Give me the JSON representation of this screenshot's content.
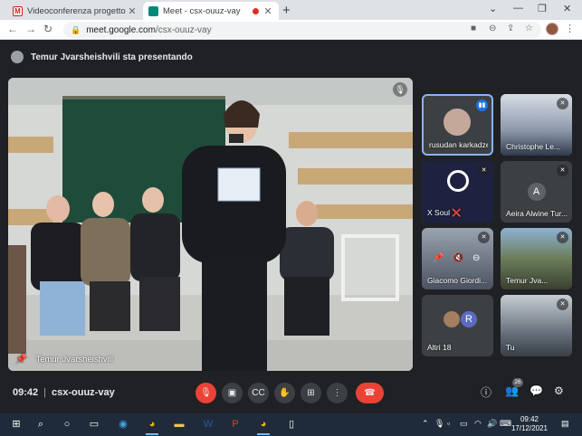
{
  "browser": {
    "tabs": [
      {
        "title": "Videoconferenza progetto interc",
        "favicon_color": "#c5221f"
      },
      {
        "title": "Meet - csx-ouuz-vay",
        "favicon_color": "#00897b",
        "recording": true
      }
    ],
    "new_tab": "+",
    "url_host": "meet.google.com",
    "url_path": "/csx-ouuz-vay"
  },
  "meet": {
    "presenting_text": "Temur Jvarsheishvili sta presentando",
    "main_speaker_name": "Temur Jvarsheishvili",
    "tiles": [
      {
        "name": "rusudan karkadze",
        "state": "speaking"
      },
      {
        "name": "Christophe Le..."
      },
      {
        "name": "X Soul ❌"
      },
      {
        "name": "Aeira Alwine Tur...",
        "letter": "A"
      },
      {
        "name": "Giacomo Giordi..."
      },
      {
        "name": "Temur Jva..."
      },
      {
        "name": "Altri 18",
        "letter": "R"
      },
      {
        "name": "Tu"
      }
    ],
    "time": "09:42",
    "meeting_code": "csx-ouuz-vay",
    "participants_count": "26"
  },
  "taskbar": {
    "clock_time": "09:42",
    "clock_date": "17/12/2021"
  },
  "colors": {
    "meet_bg": "#202124",
    "end_call": "#ea4335",
    "accent": "#8ab4f8"
  }
}
